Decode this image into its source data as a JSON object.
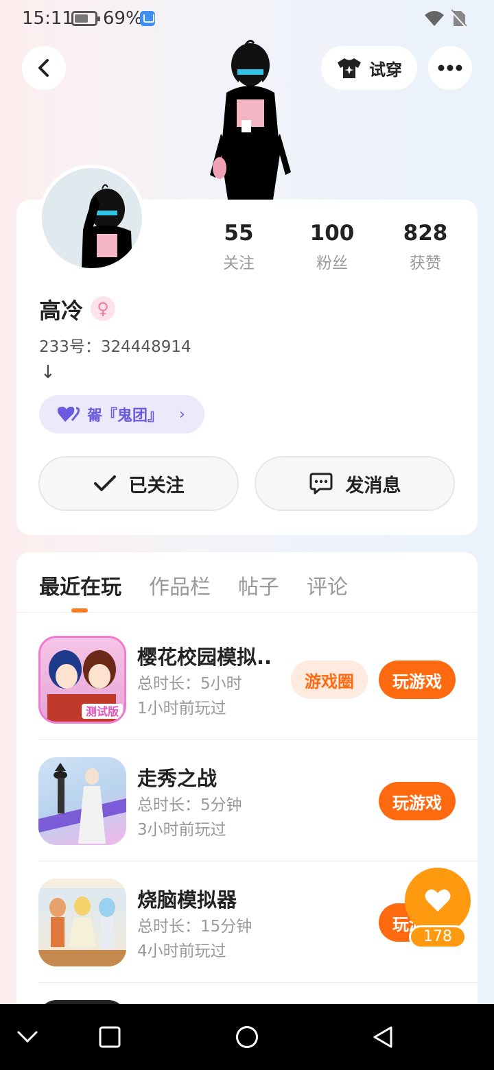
{
  "status_bar": {
    "time": "15:11",
    "battery_pct": "69%",
    "battery_level": 0.69
  },
  "header": {
    "tryon_label": "试穿"
  },
  "profile": {
    "stats": [
      {
        "value": "55",
        "label": "关注"
      },
      {
        "value": "100",
        "label": "粉丝"
      },
      {
        "value": "828",
        "label": "获赞"
      }
    ],
    "name": "高冷",
    "gender_symbol": "♀",
    "uid": "233号：324448914",
    "bio": "↓",
    "group_tag": "嗧『鬼团』",
    "follow_label": "已关注",
    "message_label": "发消息"
  },
  "tabs": [
    {
      "label": "最近在玩",
      "active": true
    },
    {
      "label": "作品栏",
      "active": false
    },
    {
      "label": "帖子",
      "active": false
    },
    {
      "label": "评论",
      "active": false
    }
  ],
  "games": [
    {
      "title": "樱花校园模拟...",
      "duration": "总时长：5小时",
      "last_played": "1小时前玩过",
      "circle_label": "游戏圈",
      "play_label": "玩游戏",
      "icon_badge": "测试版"
    },
    {
      "title": "走秀之战",
      "duration": "总时长：5分钟",
      "last_played": "3小时前玩过",
      "play_label": "玩游戏"
    },
    {
      "title": "烧脑模拟器",
      "duration": "总时长：15分钟",
      "last_played": "4小时前玩过",
      "play_label": "玩游戏"
    }
  ],
  "like_button": {
    "count": "178"
  },
  "colors": {
    "accent": "#ff6a10",
    "like": "#ff9a10",
    "group_tag": "#6b5be0"
  }
}
